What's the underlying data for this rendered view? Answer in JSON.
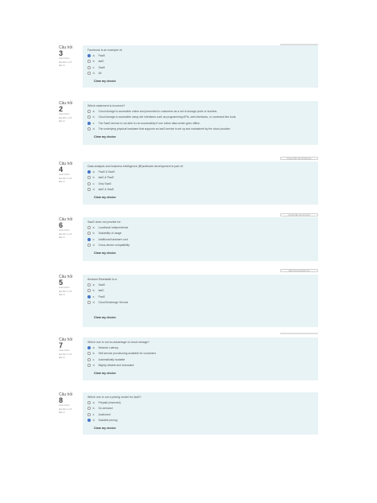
{
  "labels": {
    "question_word": "Câu hỏi",
    "clear": "Clear my choice",
    "complete": "Hoàn thành",
    "score": "Đạt điểm 1,00",
    "flag": "Đặt cờ"
  },
  "questions": [
    {
      "number": "3",
      "text": "Facebook is an example of:",
      "options": [
        {
          "letter": "a.",
          "text": "PaaS",
          "sel": true
        },
        {
          "letter": "b.",
          "text": "IaaS",
          "sel": false
        },
        {
          "letter": "c.",
          "text": "SaaS",
          "sel": false
        },
        {
          "letter": "d.",
          "text": "All",
          "sel": false
        }
      ]
    },
    {
      "number": "2",
      "text": "Which statement is incorrect?",
      "options": [
        {
          "letter": "a.",
          "text": "Cloud storage is accessible online and presented to customers as a set of storage pools or buckets.",
          "sel": false
        },
        {
          "letter": "b.",
          "text": "Cloud storage is accessible using rich interfaces such as programming APIs, web interfaces, or command line tools.",
          "sel": false
        },
        {
          "letter": "c.",
          "text": "The SaaS service is not able to run successfully if one online data center goes offline.",
          "sel": true
        },
        {
          "letter": "d.",
          "text": "The underlying physical hardware that supports an IaaS service is set up and maintained by the cloud provider.",
          "sel": false
        }
      ]
    },
    {
      "number": "4",
      "text": "Data analysis and business intelligence (BI)software development is part of:",
      "options": [
        {
          "letter": "a.",
          "text": "PaaS & SaaS",
          "sel": true
        },
        {
          "letter": "b.",
          "text": "IaaS & PaaS",
          "sel": false
        },
        {
          "letter": "c.",
          "text": "Only SaaS",
          "sel": false
        },
        {
          "letter": "d.",
          "text": "IaaS & SaaS",
          "sel": false
        }
      ]
    },
    {
      "number": "6",
      "text": "SaaS does not provide for:",
      "options": [
        {
          "letter": "a.",
          "text": "Locational independence",
          "sel": false
        },
        {
          "letter": "b.",
          "text": "Scalability of usage",
          "sel": false
        },
        {
          "letter": "c.",
          "text": "Additional hardware cost",
          "sel": true
        },
        {
          "letter": "d.",
          "text": "Cross-device compatibility",
          "sel": false
        }
      ]
    },
    {
      "number": "5",
      "text": "Amazon Beanstalk is a:",
      "options": [
        {
          "letter": "a.",
          "text": "SaaS",
          "sel": false
        },
        {
          "letter": "b.",
          "text": "IaaS",
          "sel": false
        },
        {
          "letter": "c.",
          "text": "PaaS",
          "sel": true
        },
        {
          "letter": "d.",
          "text": "Cloud Brokerage Service",
          "sel": false
        }
      ]
    },
    {
      "number": "7",
      "text": "Which one is not an advantage of cloud storage?",
      "options": [
        {
          "letter": "a.",
          "text": "Network Latency",
          "sel": true
        },
        {
          "letter": "b.",
          "text": "Self-service provisioning available for customers",
          "sel": false
        },
        {
          "letter": "c.",
          "text": "Automatically scalable",
          "sel": false
        },
        {
          "letter": "d.",
          "text": "Mighty reliable and redundant",
          "sel": false
        }
      ]
    },
    {
      "number": "8",
      "text": "Which one is not a pricing model for IaaS?",
      "options": [
        {
          "letter": "a.",
          "text": "Prepaid (reserved)",
          "sel": false
        },
        {
          "letter": "b.",
          "text": "On-demand",
          "sel": false
        },
        {
          "letter": "c.",
          "text": "Auctioned",
          "sel": false
        },
        {
          "letter": "d.",
          "text": "Scalable pricing",
          "sel": true
        }
      ]
    }
  ],
  "nav_chips": [
    "Chuyển đến câu hỏi tiếp theo",
    "Chuyển đến câu hỏi trước",
    "Điều hướng bài kiểm tra"
  ]
}
